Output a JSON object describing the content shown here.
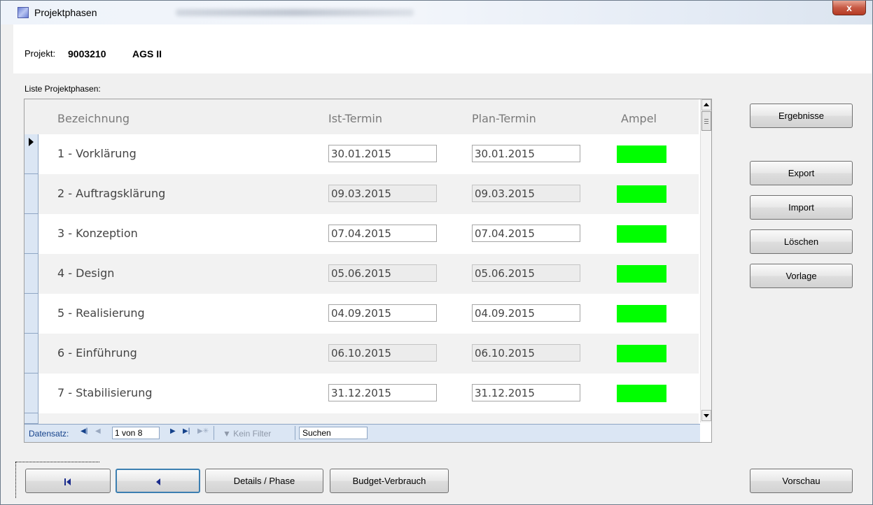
{
  "window": {
    "title": "Projektphasen",
    "close_label": "x"
  },
  "project": {
    "label": "Projekt:",
    "number": "9003210",
    "name": "AGS II"
  },
  "list": {
    "label": "Liste Projektphasen:"
  },
  "grid": {
    "headers": {
      "name": "Bezeichnung",
      "ist": "Ist-Termin",
      "plan": "Plan-Termin",
      "ampel": "Ampel"
    },
    "rows": [
      {
        "name": "1 - Vorklärung",
        "ist": "30.01.2015",
        "plan": "30.01.2015",
        "ampel_color": "#00ff00"
      },
      {
        "name": "2 - Auftragsklärung",
        "ist": "09.03.2015",
        "plan": "09.03.2015",
        "ampel_color": "#00ff00"
      },
      {
        "name": "3 - Konzeption",
        "ist": "07.04.2015",
        "plan": "07.04.2015",
        "ampel_color": "#00ff00"
      },
      {
        "name": "4 - Design",
        "ist": "05.06.2015",
        "plan": "05.06.2015",
        "ampel_color": "#00ff00"
      },
      {
        "name": "5 - Realisierung",
        "ist": "04.09.2015",
        "plan": "04.09.2015",
        "ampel_color": "#00ff00"
      },
      {
        "name": "6 - Einführung",
        "ist": "06.10.2015",
        "plan": "06.10.2015",
        "ampel_color": "#00ff00"
      },
      {
        "name": "7 - Stabilisierung",
        "ist": "31.12.2015",
        "plan": "31.12.2015",
        "ampel_color": "#00ff00"
      }
    ]
  },
  "navigator": {
    "label": "Datensatz:",
    "record": "1 von 8",
    "filter": "Kein Filter",
    "search": "Suchen",
    "icons": {
      "first": "first-record-icon",
      "prev": "prev-record-icon",
      "next": "next-record-icon",
      "last": "last-record-icon",
      "new": "new-record-icon",
      "filter": "filter-icon"
    }
  },
  "side_buttons": {
    "ergebnisse": "Ergebnisse",
    "export": "Export",
    "import": "Import",
    "loeschen": "Löschen",
    "vorlage": "Vorlage"
  },
  "bottom_buttons": {
    "details": "Details / Phase",
    "budget": "Budget-Verbrauch",
    "vorschau": "Vorschau"
  }
}
